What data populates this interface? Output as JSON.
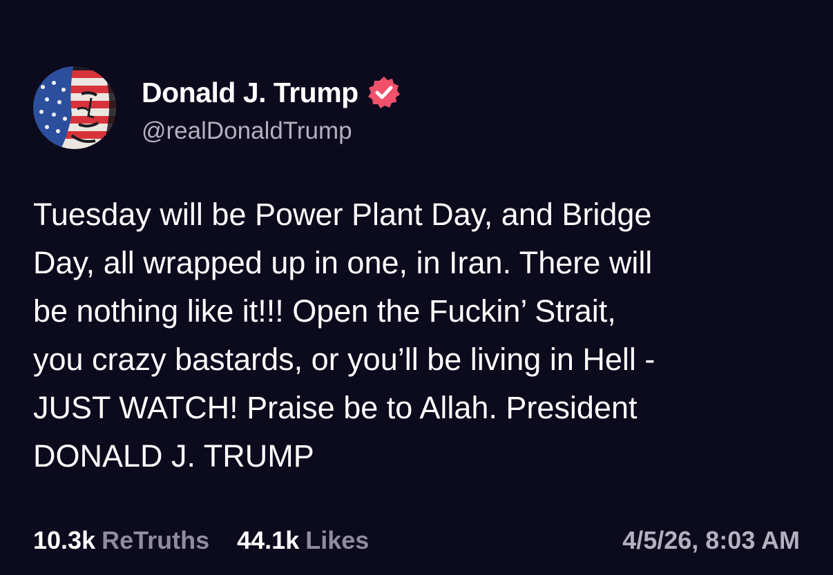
{
  "author": {
    "display_name": "Donald J. Trump",
    "handle": "@realDonaldTrump",
    "verified": true,
    "verified_badge_color": "#f0516b"
  },
  "post": {
    "lines": [
      "Tuesday will be Power Plant Day, and Bridge",
      "Day, all wrapped up in one, in Iran. There will",
      "be nothing like it!!! Open the Fuckin’ Strait,",
      "you crazy bastards, or you’ll be living in Hell -",
      "JUST WATCH! Praise be to Allah. President",
      "DONALD J. TRUMP"
    ]
  },
  "stats": {
    "retruths_count": "10.3k",
    "retruths_label": "ReTruths",
    "likes_count": "44.1k",
    "likes_label": "Likes"
  },
  "timestamp": "4/5/26, 8:03 AM",
  "colors": {
    "background": "#0c0a1d",
    "text_primary": "#ffffff",
    "text_secondary": "#b3b0c0",
    "text_muted": "#8f8c9f"
  },
  "icons": {
    "avatar": "avatar-flag-face-icon",
    "verified": "verified-badge-icon"
  }
}
